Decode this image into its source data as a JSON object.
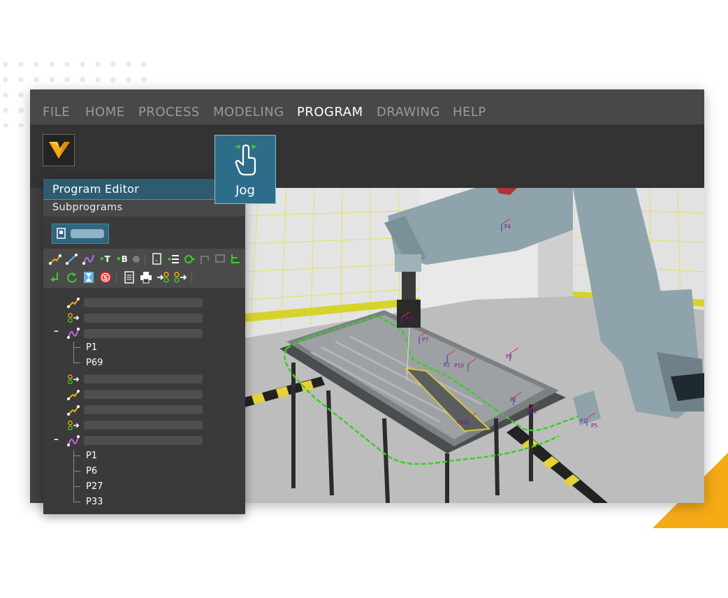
{
  "menu": {
    "items": [
      {
        "label": "FILE",
        "active": false
      },
      {
        "label": "HOME",
        "active": false
      },
      {
        "label": "PROCESS",
        "active": false
      },
      {
        "label": "MODELING",
        "active": false
      },
      {
        "label": "PROGRAM",
        "active": true
      },
      {
        "label": "DRAWING",
        "active": false
      },
      {
        "label": "HELP",
        "active": false
      }
    ]
  },
  "ribbon": {
    "jog_label": "Jog",
    "jog_icon": "hand-pointer-icon"
  },
  "program_editor": {
    "title": "Program Editor",
    "subprograms_label": "Subprograms",
    "tree": {
      "group1": {
        "points": [
          "P1",
          "P69"
        ]
      },
      "group2": {
        "points": [
          "P1",
          "P6",
          "P27",
          "P33"
        ]
      }
    }
  },
  "viewport": {
    "point_labels": [
      "P4",
      "P2",
      "P7",
      "P2",
      "P10",
      "P2",
      "P69",
      "P33",
      "P42",
      "P1",
      "P5"
    ]
  },
  "colors": {
    "accent": "#2d6d8a",
    "program_title_bg": "#2e5b70",
    "brand": "#f4ab16",
    "path_green": "#3ccc2a",
    "robot": "#8ea3ab"
  }
}
